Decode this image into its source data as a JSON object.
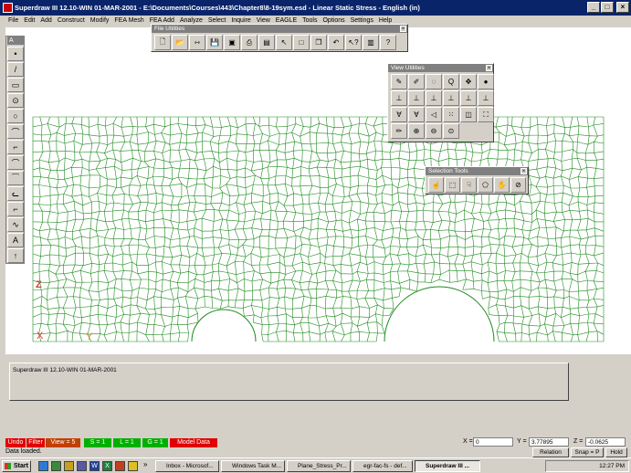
{
  "window": {
    "title": "Superdraw III 12.10-WIN 01-MAR-2001 - E:\\Documents\\Courses\\443\\Chapter8\\8-19sym.esd - Linear Static Stress - English (in)",
    "controls": [
      "_",
      "□",
      "×"
    ]
  },
  "menu": [
    "File",
    "Edit",
    "Add",
    "Construct",
    "Modify",
    "FEA Mesh",
    "FEA Add",
    "Analyze",
    "Select",
    "Inquire",
    "View",
    "EAGLE",
    "Tools",
    "Options",
    "Settings",
    "Help"
  ],
  "left_toolbar": {
    "header": "A",
    "items": [
      {
        "icon": "point-icon",
        "glyph": "•"
      },
      {
        "icon": "line-icon",
        "glyph": "/"
      },
      {
        "icon": "rectangle-icon",
        "glyph": "▭"
      },
      {
        "icon": "circle-center-icon",
        "glyph": "⊙"
      },
      {
        "icon": "circle-icon",
        "glyph": "○"
      },
      {
        "icon": "arc-icon",
        "glyph": "⌒"
      },
      {
        "icon": "fillet-icon",
        "glyph": "⌐"
      },
      {
        "icon": "arc3-icon",
        "glyph": "⌒"
      },
      {
        "icon": "arc-tangent-icon",
        "glyph": "⁀"
      },
      {
        "icon": "spline-icon",
        "glyph": "ᓚ"
      },
      {
        "icon": "conic-icon",
        "glyph": "⌐"
      },
      {
        "icon": "curve-icon",
        "glyph": "∿"
      },
      {
        "icon": "text-icon",
        "glyph": "A"
      },
      {
        "icon": "arrow-up-icon",
        "glyph": "↑"
      }
    ]
  },
  "file_utilities": {
    "title": "File Utilities",
    "buttons": [
      {
        "icon": "new-file-icon",
        "glyph": "🗋"
      },
      {
        "icon": "open-folder-icon",
        "glyph": "📂"
      },
      {
        "icon": "merge-icon",
        "glyph": "⇿"
      },
      {
        "icon": "save-icon",
        "glyph": "💾"
      },
      {
        "icon": "save-as-icon",
        "glyph": "▣"
      },
      {
        "icon": "print-icon",
        "glyph": "⎙"
      },
      {
        "icon": "plot-icon",
        "glyph": "▤"
      },
      {
        "icon": "pointer-icon",
        "glyph": "↖"
      },
      {
        "icon": "blank-icon",
        "glyph": "□"
      },
      {
        "icon": "copy-icon",
        "glyph": "❐"
      },
      {
        "icon": "undo-icon",
        "glyph": "↶"
      },
      {
        "icon": "whats-this-icon",
        "glyph": "↖?"
      },
      {
        "icon": "screen-icon",
        "glyph": "▥"
      },
      {
        "icon": "help-icon",
        "glyph": "?"
      }
    ]
  },
  "view_utilities": {
    "title": "View Utilities",
    "buttons": [
      {
        "icon": "redraw-icon",
        "glyph": "✎"
      },
      {
        "icon": "shade-icon",
        "glyph": "✐"
      },
      {
        "icon": "rotate-icon",
        "glyph": "◌"
      },
      {
        "icon": "zoom-window-icon",
        "glyph": "Q"
      },
      {
        "icon": "pan-icon",
        "glyph": "✥"
      },
      {
        "icon": "sphere-icon",
        "glyph": "●"
      },
      {
        "icon": "view-xy-icon",
        "glyph": "⊥"
      },
      {
        "icon": "view-yz-icon",
        "glyph": "⊥"
      },
      {
        "icon": "view-xz-icon",
        "glyph": "⊥"
      },
      {
        "icon": "view-iso-icon",
        "glyph": "⊥"
      },
      {
        "icon": "view-iso2-icon",
        "glyph": "⊥"
      },
      {
        "icon": "view-iso3-icon",
        "glyph": "⊥"
      },
      {
        "icon": "view-oblique-icon",
        "glyph": "∀"
      },
      {
        "icon": "view-oblique2-icon",
        "glyph": "∀"
      },
      {
        "icon": "view-dim-icon",
        "glyph": "◁"
      },
      {
        "icon": "view-points-icon",
        "glyph": "⁙"
      },
      {
        "icon": "view-box-icon",
        "glyph": "◫"
      },
      {
        "icon": "view-all-icon",
        "glyph": "⛶"
      },
      {
        "icon": "pen-icon",
        "glyph": "✏"
      },
      {
        "icon": "zoom-in-icon",
        "glyph": "⊕"
      },
      {
        "icon": "zoom-out-icon",
        "glyph": "⊖"
      },
      {
        "icon": "zoom-icon",
        "glyph": "⊙"
      }
    ]
  },
  "selection_tools": {
    "title": "Selection Tools",
    "buttons": [
      {
        "icon": "select-pointer-icon",
        "glyph": "☝"
      },
      {
        "icon": "select-box-icon",
        "glyph": "⬚"
      },
      {
        "icon": "select-multi-icon",
        "glyph": "☟"
      },
      {
        "icon": "select-poly-icon",
        "glyph": "⬠"
      },
      {
        "icon": "select-hand-icon",
        "glyph": "✋"
      },
      {
        "icon": "deselect-icon",
        "glyph": "⊘"
      }
    ]
  },
  "axis": {
    "x": "X",
    "y": "Y",
    "z": "Z"
  },
  "mesh": {
    "color": "#1e8a1e"
  },
  "message_panel": {
    "text": "Superdraw III 12.10-WIN 01-MAR-2001"
  },
  "status_buttons": {
    "undo": "Undo",
    "filter": "Filter",
    "view": "View = 5",
    "s": "S = 1",
    "l": "L = 1",
    "g": "G = 1",
    "model": "Model Data"
  },
  "coords": {
    "x_label": "X =",
    "x_value": "0",
    "y_label": "Y =",
    "y_value": "3.77895",
    "z_label": "Z =",
    "z_value": "-0.0625"
  },
  "status_line": "Data loaded.",
  "mode_buttons": {
    "relation": "Relation",
    "snap": "Snap = P",
    "hold": "Hold"
  },
  "taskbar": {
    "start": "Start",
    "quicklaunch_overflow": "»",
    "tasks": [
      "Inbox - Microsof...",
      "Windows Task M...",
      "Plane_Stress_Pr...",
      "egr-fac-fs - def...",
      "Superdraw III ..."
    ],
    "clock": "12:27 PM"
  }
}
